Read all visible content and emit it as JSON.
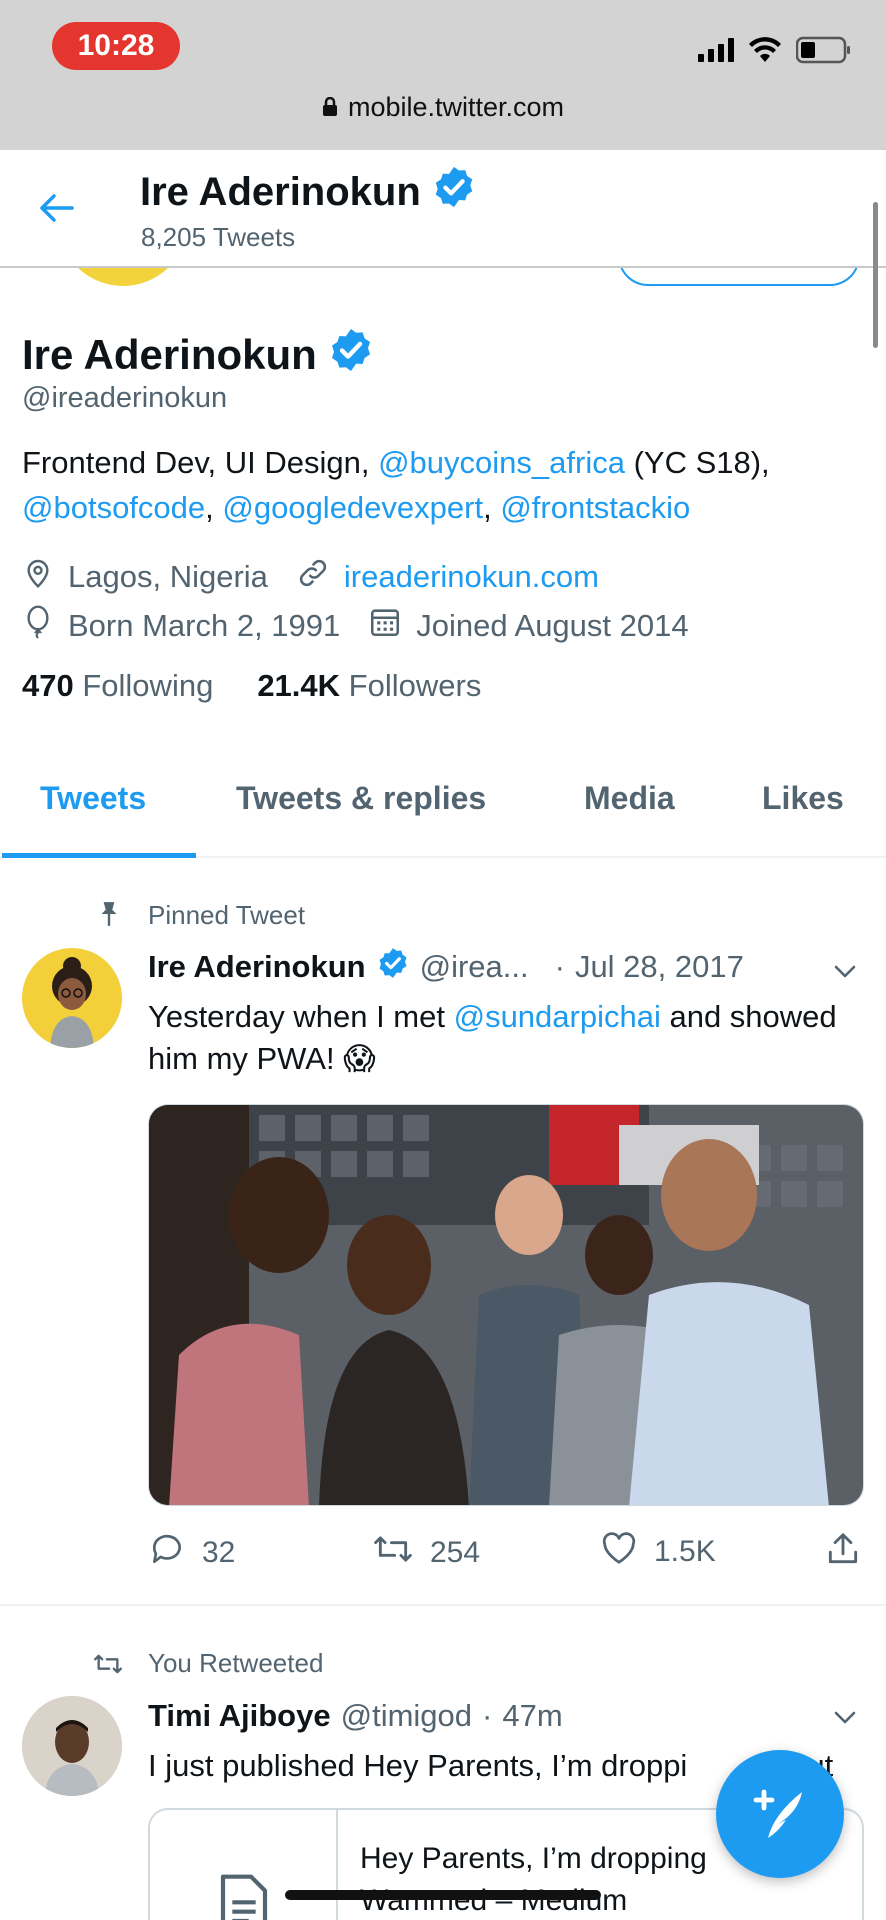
{
  "status_bar": {
    "time": "10:28"
  },
  "browser": {
    "url": "mobile.twitter.com"
  },
  "header": {
    "name": "Ire Aderinokun",
    "tweet_count": "8,205 Tweets"
  },
  "profile": {
    "name": "Ire Aderinokun",
    "handle": "@ireaderinokun",
    "bio": {
      "p1": "Frontend Dev, UI Design, ",
      "m1": "@buycoins_africa",
      "p2": " (YC S18),",
      "m2": "@botsofcode",
      "p3": ", ",
      "m3": "@googledevexpert",
      "p4": ", ",
      "m4": "@frontstackio"
    },
    "location": "Lagos, Nigeria",
    "website": "ireaderinokun.com",
    "birthday": "Born March 2, 1991",
    "joined": "Joined August 2014",
    "following_count": "470",
    "following_label": "Following",
    "followers_count": "21.4K",
    "followers_label": "Followers"
  },
  "tabs": [
    "Tweets",
    "Tweets & replies",
    "Media",
    "Likes"
  ],
  "tweets": [
    {
      "context": "Pinned Tweet",
      "name": "Ire Aderinokun",
      "handle": "@irea...",
      "sep": "·",
      "date": "Jul 28, 2017",
      "text_a": "Yesterday when I met ",
      "mention": "@sundarpichai",
      "text_b": " and showed him my PWA! ",
      "emoji": "😱",
      "replies": "32",
      "retweets": "254",
      "likes": "1.5K"
    },
    {
      "context": "You Retweeted",
      "name": "Timi Ajiboye",
      "handle": "@timigod",
      "sep": "·",
      "date": "47m",
      "text": "I just published Hey Parents, I’m droppi",
      "text_tail": "ut",
      "card_title": "Hey Parents, I’m dropping",
      "card_title_tail": "–",
      "card_source": "Wammed – Medium"
    }
  ],
  "colors": {
    "accent": "#1d9bf0",
    "text": "#0f1419",
    "muted": "#536471"
  }
}
